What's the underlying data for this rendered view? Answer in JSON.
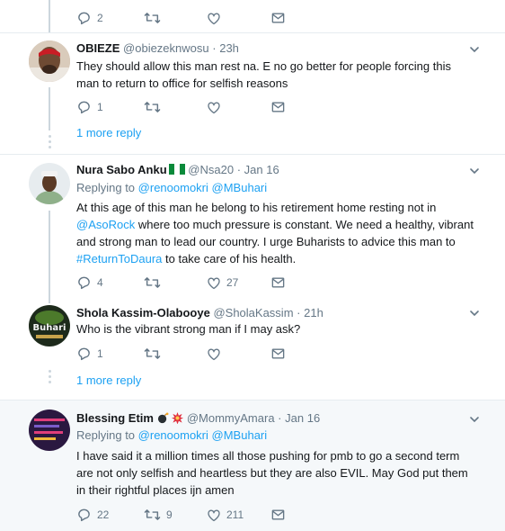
{
  "top_actions": {
    "reply_count": "2",
    "retweet_count": "",
    "like_count": ""
  },
  "tweets": [
    {
      "name": "OBIEZE",
      "handle": "@obiezeknwosu",
      "sep": "·",
      "time": "23h",
      "lines": [
        "They should allow this man rest na. E no go better for people forcing this",
        "man to return to office for selfish reasons"
      ],
      "reply_count": "1",
      "retweet_count": "",
      "like_count": "",
      "more_replies": "1 more reply"
    },
    {
      "name": "Nura Sabo Anku",
      "handle": "@Nsa20",
      "sep": "·",
      "time": "Jan 16",
      "replying_label": "Replying to",
      "replying_a": "@renoomokri",
      "replying_b": "@MBuhari",
      "l1": "At this age of this man he belong to his retirement home resting not in",
      "l2_link": "@AsoRock",
      "l2_rest": " where too much pressure is constant. We need a healthy, vibrant",
      "l3": "and strong man to lead our country. I urge Buharists to advice this man to",
      "l4_link": "#ReturnToDaura",
      "l4_rest": " to take care of his health.",
      "reply_count": "4",
      "retweet_count": "",
      "like_count": "27"
    },
    {
      "name": "Shola Kassim-Olabooye",
      "handle": "@SholaKassim",
      "sep": "·",
      "time": "21h",
      "lines": [
        "Who is the vibrant strong man if I may ask?"
      ],
      "reply_count": "1",
      "retweet_count": "",
      "like_count": "",
      "more_replies": "1 more reply",
      "avatar_text": "Buhari"
    },
    {
      "name": "Blessing Etim",
      "handle": "@MommyAmara",
      "sep": "·",
      "time": "Jan 16",
      "replying_label": "Replying to",
      "replying_a": "@renoomokri",
      "replying_b": "@MBuhari",
      "lines": [
        "I have said it a million times all those pushing for pmb to go a second term",
        "are not only selfish and heartless but they are also EVIL. May God put them",
        "in their rightful places ijn amen"
      ],
      "reply_count": "22",
      "retweet_count": "9",
      "like_count": "211"
    }
  ],
  "colors": {
    "accent": "#1da1f2",
    "muted": "#657786",
    "line": "#ccd6dd",
    "highlight_bg": "#f5f8fa"
  }
}
